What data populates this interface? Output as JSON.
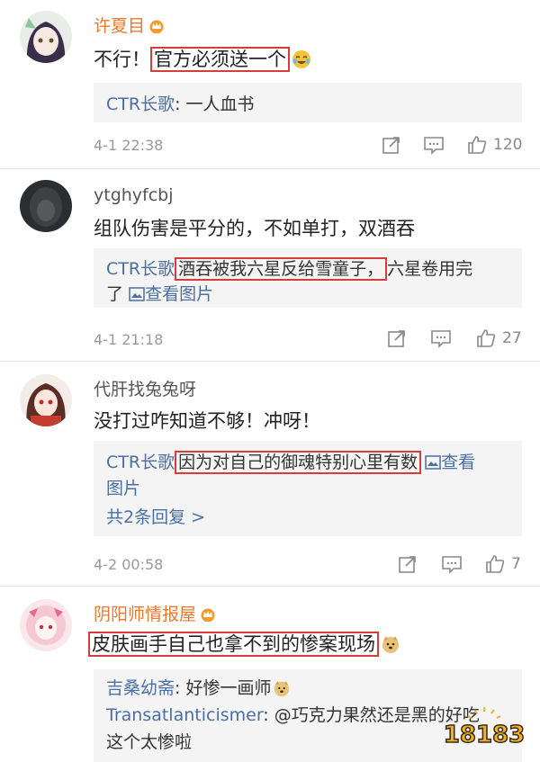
{
  "comments": [
    {
      "username": "许夏目",
      "prefix": "不行！",
      "highlight": "官方必须送一个",
      "reply_author": "CTR长歌",
      "reply_text": ": 一人血书",
      "time": "4-1 22:38",
      "likes": "120"
    },
    {
      "username": "ytghyfcbj",
      "text": "组队伤害是平分的，不如单打，双酒吞",
      "reply_author": "CTR长歌",
      "reply_highlight": "酒吞被我六星反给雪童子，",
      "reply_rest": "六星卷用完",
      "reply_line2_prefix": "了",
      "view_image": "查看图片",
      "time": "4-1 21:18",
      "likes": "27"
    },
    {
      "username": "代肝找兔兔呀",
      "text": "没打过咋知道不够！冲呀！",
      "reply_author": "CTR长歌",
      "reply_highlight": "因为对自己的御魂特别心里有数",
      "view_image_a": "查看",
      "view_image_b": "图片",
      "more_replies": "共2条回复 >",
      "time": "4-2 00:58",
      "likes": "7"
    },
    {
      "username": "阴阳师情报屋",
      "highlight": "皮肤画手自己也拿不到的惨案现场",
      "reply1_author": "吉桑幼斋",
      "reply1_text": ": 好惨一画师",
      "reply2_author": "Transatlanticismer",
      "reply2_text": ": @巧克力果然还是黑的好吃",
      "reply3_text": "这个太惨啦"
    }
  ],
  "watermark": "18183",
  "colors": {
    "link": "#4a6fa5",
    "highlight_border": "#d93a3a",
    "vip_name": "#e8792f"
  }
}
